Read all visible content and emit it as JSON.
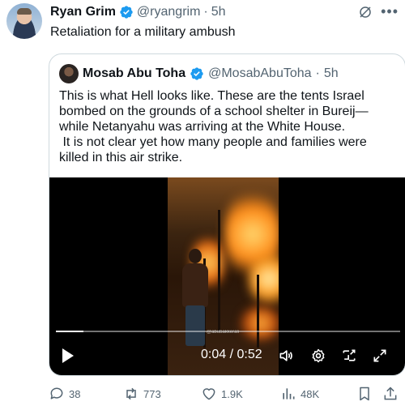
{
  "author": {
    "name": "Ryan Grim",
    "handle": "@ryangrim",
    "separator": "·",
    "time": "5h",
    "text": "Retaliation for a military ambush"
  },
  "quoted": {
    "name": "Mosab Abu Toha",
    "handle": "@MosabAbuToha",
    "separator": "·",
    "time": "5h",
    "text_lines": [
      "This is what Hell looks like. These are the tents Israel",
      "bombed on the grounds of a school shelter in Bureij—",
      "while Netanyahu was arriving at the White House.",
      " It is not clear yet how many people and families were",
      "killed in this air strike."
    ]
  },
  "video": {
    "current_time": "0:04",
    "time_separator": "/",
    "duration": "0:52",
    "progress": 0.08,
    "watermark": "@abubakkerali"
  },
  "actions": {
    "replies": "38",
    "reposts": "773",
    "likes": "1.9K",
    "views": "48K"
  },
  "icons": {
    "verified": "verified-badge-icon",
    "grok": "grok-icon",
    "more": "more-icon",
    "play": "play-icon",
    "volume": "volume-icon",
    "settings": "settings-icon",
    "pip": "picture-in-picture-icon",
    "fullscreen": "fullscreen-icon",
    "reply": "reply-icon",
    "repost": "repost-icon",
    "like": "like-icon",
    "views": "views-icon",
    "bookmark": "bookmark-icon",
    "share": "share-icon"
  },
  "colors": {
    "verified": "#1d9bf0",
    "text": "#0f1419",
    "secondary": "#536471",
    "border": "#cfd9de"
  }
}
